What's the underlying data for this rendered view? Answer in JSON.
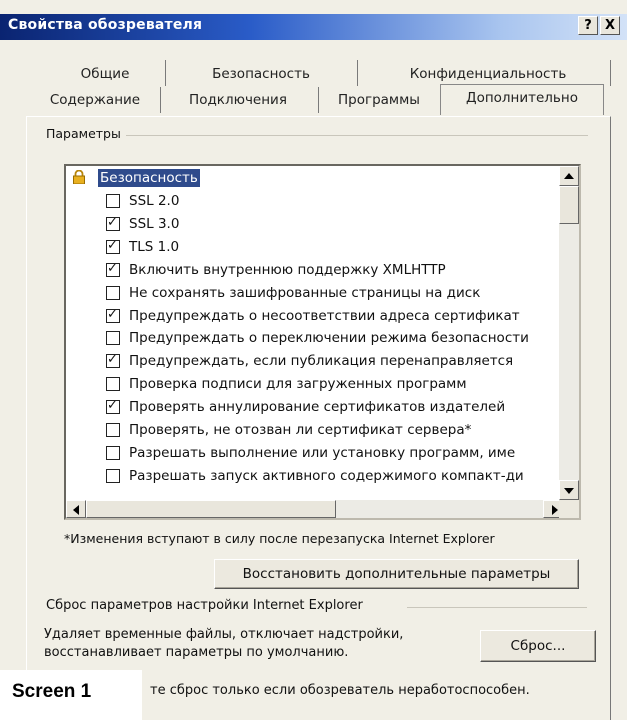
{
  "window": {
    "title": "Свойства обозревателя",
    "help_button": "?",
    "close_button": "X"
  },
  "tabs_row1": [
    "Общие",
    "Безопасность",
    "Конфиденциальность"
  ],
  "tabs_row2": [
    "Содержание",
    "Подключения",
    "Программы",
    "Дополнительно"
  ],
  "active_tab": "Дополнительно",
  "settings_group_label": "Параметры",
  "settings": {
    "category": "Безопасность",
    "category_icon": "lock-icon",
    "items": [
      {
        "label": "SSL 2.0",
        "checked": false
      },
      {
        "label": "SSL 3.0",
        "checked": true
      },
      {
        "label": "TLS 1.0",
        "checked": true
      },
      {
        "label": "Включить внутреннюю поддержку XMLHTTP",
        "checked": true
      },
      {
        "label": "Не сохранять зашифрованные страницы на диск",
        "checked": false
      },
      {
        "label": "Предупреждать о несоответствии адреса сертификат",
        "checked": true
      },
      {
        "label": "Предупреждать о переключении режима безопасности",
        "checked": false
      },
      {
        "label": "Предупреждать, если публикация перенаправляется",
        "checked": true
      },
      {
        "label": "Проверка подписи для загруженных программ",
        "checked": false
      },
      {
        "label": "Проверять аннулирование сертификатов издателей",
        "checked": true
      },
      {
        "label": "Проверять, не отозван ли сертификат сервера*",
        "checked": false
      },
      {
        "label": "Разрешать выполнение или установку программ, име",
        "checked": false
      },
      {
        "label": "Разрешать запуск активного содержимого компакт-ди",
        "checked": false
      }
    ]
  },
  "restart_note": "*Изменения вступают в силу после перезапуска Internet Explorer",
  "restore_button": "Восстановить дополнительные параметры",
  "reset_group_label": "Сброс параметров настройки Internet Explorer",
  "reset_description": "Удаляет временные файлы, отключает надстройки, восстанавливает параметры по умолчанию.",
  "reset_button": "Сброс...",
  "reset_warning": "те сброс только если обозреватель неработоспособен.",
  "caption": "Screen 1"
}
